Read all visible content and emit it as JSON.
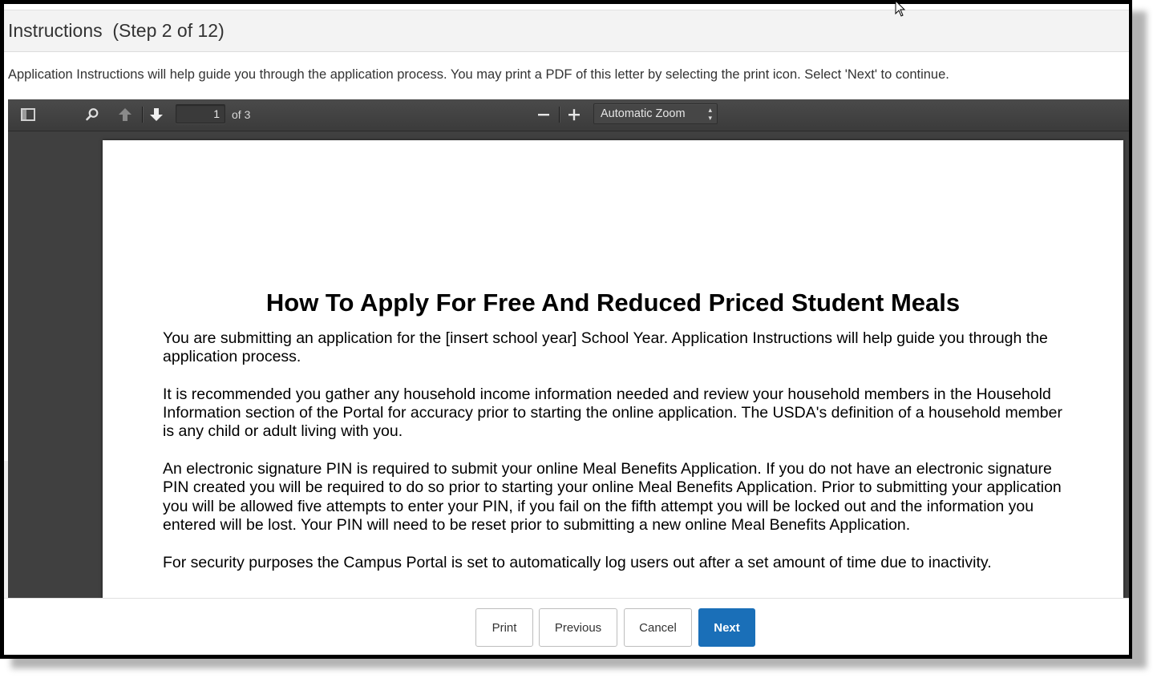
{
  "header": {
    "title": "Instructions  (Step 2 of 12)"
  },
  "intro_text": "Application Instructions will help guide you through the application process. You may print a PDF of this letter by selecting the print icon. Select 'Next' to continue.",
  "pdf_viewer": {
    "toolbar": {
      "sidebar_toggle_icon": "sidebar-toggle-icon",
      "search_icon": "search-icon",
      "previous_page_icon": "arrow-up-icon",
      "next_page_icon": "arrow-down-icon",
      "current_page": "1",
      "page_count_label": "of 3",
      "zoom_out_icon": "minus-icon",
      "zoom_in_icon": "plus-icon",
      "zoom_selected": "Automatic Zoom"
    },
    "document": {
      "heading": "How To Apply For Free And Reduced Priced Student Meals",
      "paragraphs": [
        "You are submitting an application for the [insert school year] School Year. Application Instructions will help guide you through the application process.",
        "It is recommended you gather any household income information needed and review your household members in the Household Information section of the Portal for accuracy prior to starting the online application. The USDA's definition of a household member is any child or adult living with you.",
        "An electronic signature PIN is required to submit your online Meal Benefits Application. If you do not have an electronic signature PIN created you will be required to do so prior to starting your online Meal Benefits Application. Prior to submitting your application you will be allowed five attempts to enter your PIN, if you fail on the fifth attempt you will be locked out and the information you entered will be lost. Your PIN will need to be reset prior to submitting a new online Meal Benefits Application.",
        "For security purposes the Campus Portal is set to automatically log users out after a set amount of time due to inactivity."
      ]
    }
  },
  "footer": {
    "print_label": "Print",
    "previous_label": "Previous",
    "cancel_label": "Cancel",
    "next_label": "Next"
  },
  "colors": {
    "primary": "#1a6fb8",
    "viewer_bg": "#404040",
    "header_bg": "#f3f3f3"
  }
}
